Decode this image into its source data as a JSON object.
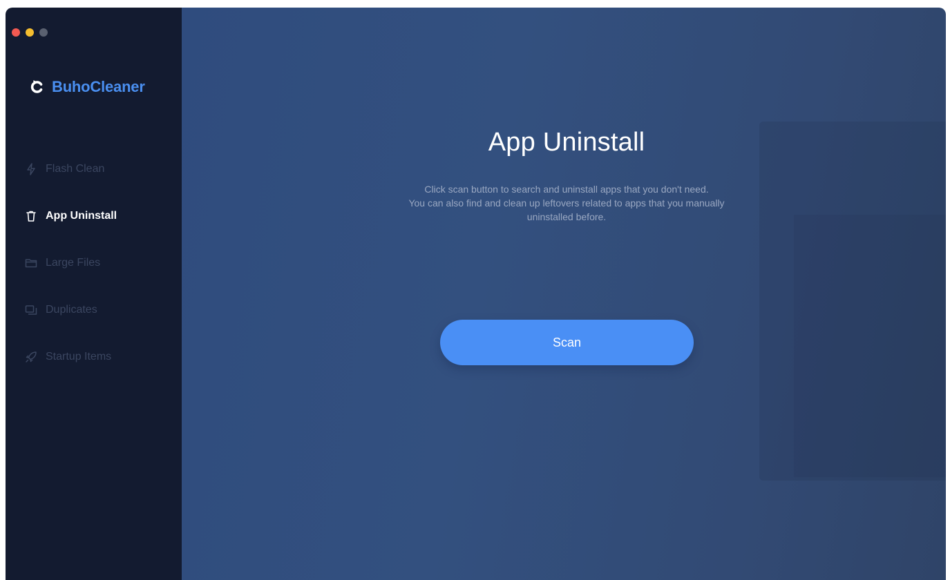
{
  "window": {
    "controls": [
      "close",
      "minimize",
      "zoom"
    ]
  },
  "sidebar": {
    "brand": "BuhoCleaner",
    "items": [
      {
        "label": "Flash Clean",
        "icon": "flash-icon",
        "active": false
      },
      {
        "label": "App Uninstall",
        "icon": "trash-icon",
        "active": true
      },
      {
        "label": "Large Files",
        "icon": "folder-icon",
        "active": false
      },
      {
        "label": "Duplicates",
        "icon": "duplicates-icon",
        "active": false
      },
      {
        "label": "Startup Items",
        "icon": "rocket-icon",
        "active": false
      }
    ]
  },
  "main": {
    "title": "App Uninstall",
    "description_lines": [
      "Click scan button to search and uninstall apps that you don't need.",
      "You can also find and clean up leftovers related to apps that you manually",
      "uninstalled before."
    ],
    "scan_label": "Scan"
  },
  "colors": {
    "accent": "#4a8ff5",
    "sidebar_bg": "#131b30",
    "main_bg": "#32507f",
    "brand": "#4a8ff0"
  }
}
